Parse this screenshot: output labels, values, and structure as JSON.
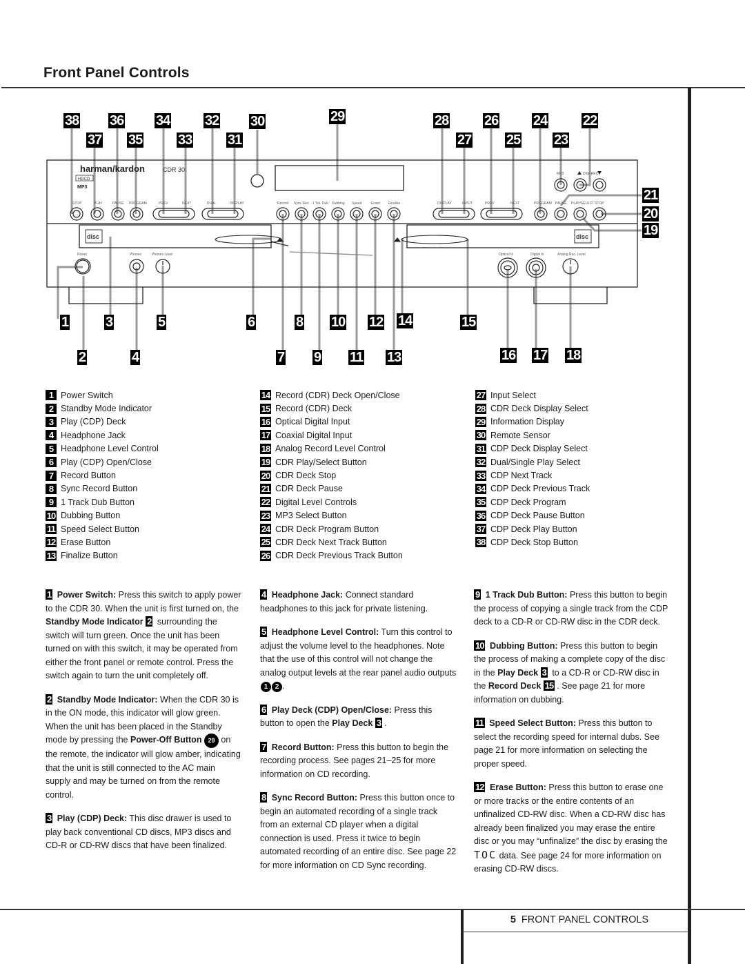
{
  "page": {
    "title": "Front Panel Controls",
    "footer": {
      "page_number": "5",
      "section": "FRONT PANEL CONTROLS"
    }
  },
  "device": {
    "brand": "harman/kardon",
    "model": "CDR 30",
    "badges": [
      "HDCD",
      "MP3"
    ],
    "cdp_button_labels": [
      "STOP",
      "PLAY",
      "PAUSE",
      "PROGRAM",
      "PREV",
      "NEXT",
      "DUAL",
      "DISPLAY"
    ],
    "center_button_labels": [
      "Record",
      "Sync Rec.",
      "1 Trk. Dub",
      "Dubbing",
      "Speed",
      "Erase",
      "Finalize"
    ],
    "cdr_button_labels": [
      "DISPLAY",
      "INPUT",
      "PREV",
      "NEXT",
      "PROGRAM",
      "PAUSE",
      "PLAY/SELECT",
      "STOP"
    ],
    "top_right_labels": [
      "MP3",
      "DIGI REC"
    ],
    "lower_labels": [
      "Power",
      "Phones",
      "Phones Level",
      "Optical In",
      "Digital In",
      "Analog Rec. Level"
    ]
  },
  "callouts": [
    "1",
    "2",
    "3",
    "4",
    "5",
    "6",
    "7",
    "8",
    "9",
    "10",
    "11",
    "12",
    "13",
    "14",
    "15",
    "16",
    "17",
    "18",
    "19",
    "20",
    "21",
    "22",
    "23",
    "24",
    "25",
    "26",
    "27",
    "28",
    "29",
    "30",
    "31",
    "32",
    "33",
    "34",
    "35",
    "36",
    "37",
    "38"
  ],
  "legend": {
    "col1": [
      {
        "n": "1",
        "label": "Power Switch"
      },
      {
        "n": "2",
        "label": "Standby Mode Indicator"
      },
      {
        "n": "3",
        "label": "Play (CDP) Deck"
      },
      {
        "n": "4",
        "label": "Headphone Jack"
      },
      {
        "n": "5",
        "label": "Headphone Level Control"
      },
      {
        "n": "6",
        "label": "Play (CDP) Open/Close"
      },
      {
        "n": "7",
        "label": "Record Button"
      },
      {
        "n": "8",
        "label": "Sync Record Button"
      },
      {
        "n": "9",
        "label": "1 Track Dub Button"
      },
      {
        "n": "10",
        "label": "Dubbing Button"
      },
      {
        "n": "11",
        "label": "Speed Select Button"
      },
      {
        "n": "12",
        "label": "Erase Button"
      },
      {
        "n": "13",
        "label": "Finalize Button"
      }
    ],
    "col2": [
      {
        "n": "14",
        "label": "Record (CDR) Deck Open/Close"
      },
      {
        "n": "15",
        "label": "Record (CDR) Deck"
      },
      {
        "n": "16",
        "label": "Optical Digital Input"
      },
      {
        "n": "17",
        "label": "Coaxial Digital Input"
      },
      {
        "n": "18",
        "label": "Analog Record Level Control"
      },
      {
        "n": "19",
        "label": "CDR Play/Select Button"
      },
      {
        "n": "20",
        "label": "CDR Deck Stop"
      },
      {
        "n": "21",
        "label": "CDR Deck Pause"
      },
      {
        "n": "22",
        "label": "Digital Level Controls"
      },
      {
        "n": "23",
        "label": "MP3 Select Button"
      },
      {
        "n": "24",
        "label": "CDR Deck Program Button"
      },
      {
        "n": "25",
        "label": "CDR Deck Next Track Button"
      },
      {
        "n": "26",
        "label": "CDR Deck Previous Track Button"
      }
    ],
    "col3": [
      {
        "n": "27",
        "label": "Input Select"
      },
      {
        "n": "28",
        "label": "CDR Deck Display Select"
      },
      {
        "n": "29",
        "label": "Information Display"
      },
      {
        "n": "30",
        "label": "Remote Sensor"
      },
      {
        "n": "31",
        "label": "CDP Deck Display Select"
      },
      {
        "n": "32",
        "label": "Dual/Single Play Select"
      },
      {
        "n": "33",
        "label": "CDP Next Track"
      },
      {
        "n": "34",
        "label": "CDP Deck Previous Track"
      },
      {
        "n": "35",
        "label": "CDP Deck Program"
      },
      {
        "n": "36",
        "label": "CDP Deck Pause Button"
      },
      {
        "n": "37",
        "label": "CDP Deck Play Button"
      },
      {
        "n": "38",
        "label": "CDP Deck Stop Button"
      }
    ]
  },
  "descriptions": {
    "d1": {
      "n": "1",
      "title": "Power Switch:",
      "t1": " Press this switch to apply power to the CDR 30. When the unit is first turned on, the ",
      "b1": "Standby Mode Indicator",
      "r1": "2",
      "t2": " surrounding the switch will turn green. Once the unit has been turned on with this switch, it may be operated from either the front panel or remote control. Press the switch again to turn the unit completely off."
    },
    "d2": {
      "n": "2",
      "title": "Standby Mode Indicator:",
      "t1": " When the CDR 30 is in the ON mode, this indicator will glow green. When the unit has been placed in the Standby mode by pressing the ",
      "b1": "Power-Off Button",
      "r1": "29",
      "t2": " on the remote, the indicator will glow amber, indicating that the unit is still connected to the AC main supply and may be turned on from the remote control."
    },
    "d3": {
      "n": "3",
      "title": "Play (CDP) Deck:",
      "t1": " This disc drawer is used to play back conventional CD discs, MP3 discs and CD-R or CD-RW discs that have been finalized."
    },
    "d4": {
      "n": "4",
      "title": "Headphone Jack:",
      "t1": " Connect standard headphones to this jack for private listening."
    },
    "d5": {
      "n": "5",
      "title": "Headphone Level Control:",
      "t1": " Turn this control to adjust the volume level to the headphones. Note that the use of this control will not change the analog output levels at the rear panel audio outputs ",
      "r1": "1",
      "r2": "2",
      "t2": "."
    },
    "d6": {
      "n": "6",
      "title": "Play Deck (CDP) Open/Close:",
      "t1": " Press this button to open the ",
      "b1": "Play Deck",
      "r1": "3",
      "t2": "."
    },
    "d7": {
      "n": "7",
      "title": "Record Button:",
      "t1": " Press this button to begin the recording process. See pages 21–25 for more information on CD recording."
    },
    "d8": {
      "n": "8",
      "title": "Sync Record Button:",
      "t1": " Press this button once to begin an automated recording of a single track from an external CD player when a digital connection is used. Press it twice to begin automated recording of an entire disc. See page 22 for more information on CD Sync recording."
    },
    "d9": {
      "n": "9",
      "title": "1 Track Dub Button:",
      "t1": " Press this button to begin the process of copying a single track from the CDP deck to a CD-R or CD-RW disc in the CDR deck."
    },
    "d10": {
      "n": "10",
      "title": "Dubbing Button:",
      "t1": " Press this button to begin the process of making a complete copy of the disc in the ",
      "b1": "Play Deck",
      "r1": "3",
      "t2": " to a CD-R or CD-RW disc in the ",
      "b2": "Record Deck",
      "r2": "15",
      "t3": ". See page 21 for more information on dubbing."
    },
    "d11": {
      "n": "11",
      "title": "Speed Select Button:",
      "t1": " Press this button to select the recording speed for internal dubs. See page 21 for more information on selecting the proper speed."
    },
    "d12": {
      "n": "12",
      "title": "Erase Button:",
      "t1": " Press this button to erase one or more tracks or the entire contents of an unfinalized CD-RW disc. When a CD-RW disc has already been finalized you may erase the entire disc or you may “unfinalize” the disc by erasing the ",
      "toc": "TOC",
      "t2": " data. See page 24 for more information on erasing CD-RW discs."
    }
  }
}
